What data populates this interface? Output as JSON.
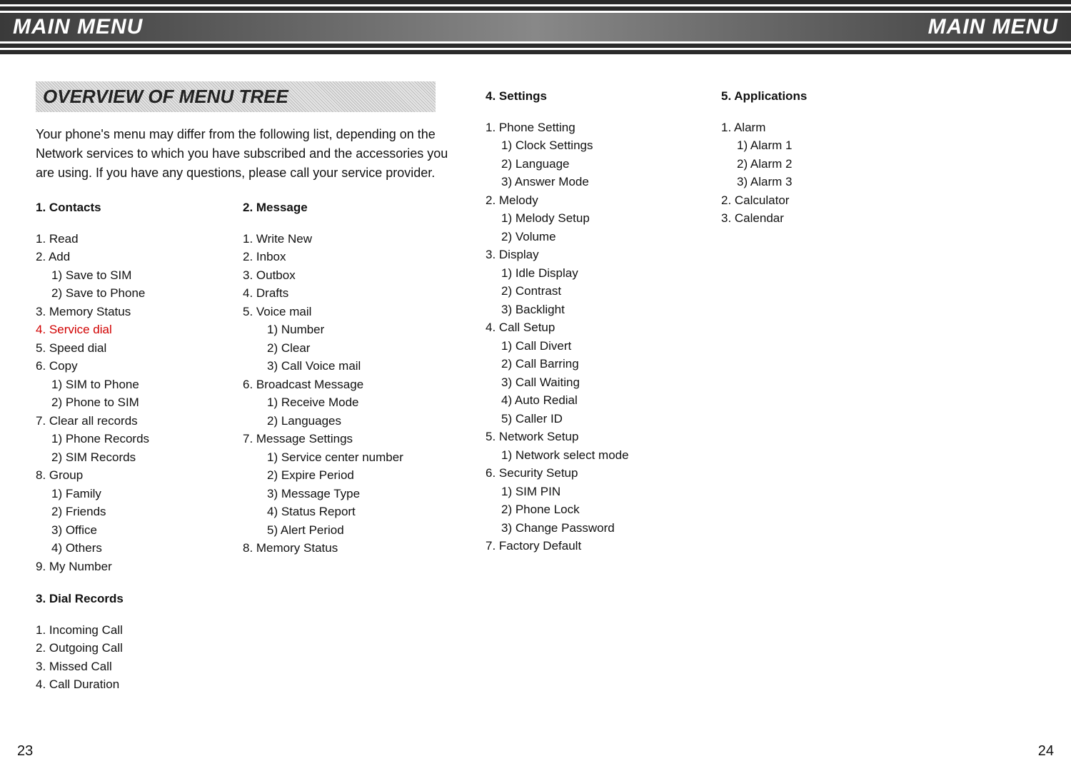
{
  "header": {
    "left_title": "MAIN MENU",
    "right_title": "MAIN MENU"
  },
  "section_header": "OVERVIEW OF MENU TREE",
  "intro": "Your phone's menu may differ from the following list, depending on the Network services to which you have subscribed and the accessories you are using. If you have any questions, please call your service provider.",
  "menu1": {
    "title": "1.   Contacts",
    "items": {
      "i1": "1. Read",
      "i2": "2. Add",
      "i2a": "1) Save to SIM",
      "i2b": "2) Save to Phone",
      "i3": "3. Memory Status",
      "i4": "4. Service dial",
      "i5": "5. Speed dial",
      "i6": "6. Copy",
      "i6a": "1) SIM to Phone",
      "i6b": "2) Phone to SIM",
      "i7": "7. Clear all records",
      "i7a": "1) Phone Records",
      "i7b": "2) SIM Records",
      "i8": "8. Group",
      "i8a": "1) Family",
      "i8b": "2) Friends",
      "i8c": "3) Office",
      "i8d": "4) Others",
      "i9": "9. My Number"
    }
  },
  "menu2": {
    "title": "2.     Message",
    "items": {
      "i1": "1. Write New",
      "i2": "2. Inbox",
      "i3": "3. Outbox",
      "i4": "4. Drafts",
      "i5": " 5. Voice mail",
      "i5a": "1) Number",
      "i5b": "2) Clear",
      "i5c": " 3) Call Voice mail",
      "i6": "6. Broadcast Message",
      "i6a": "1) Receive Mode",
      "i6b": "2) Languages",
      "i7": "7. Message Settings",
      "i7a": "1) Service center number",
      "i7b": "2) Expire Period",
      "i7c": "3) Message Type",
      "i7d": "4) Status Report",
      "i7e": "5) Alert Period",
      "i8": "8. Memory Status"
    }
  },
  "menu3": {
    "title": "3.  Dial Records",
    "items": {
      "i1": "1. Incoming Call",
      "i2": "2. Outgoing Call",
      "i3": "3. Missed Call",
      "i4": "4. Call Duration"
    }
  },
  "menu4": {
    "title": "4.  Settings",
    "items": {
      "i1": "1. Phone Setting",
      "i1a": "1) Clock Settings",
      "i1b": "2) Language",
      "i1c": "3) Answer Mode",
      "i2": "2. Melody",
      "i2a": "1) Melody Setup",
      "i2b": "2) Volume",
      "i3": "3. Display",
      "i3a": "1) Idle Display",
      "i3b": "2) Contrast",
      "i3c": "3) Backlight",
      "i4": "4. Call Setup",
      "i4a": "1) Call Divert",
      "i4b": "2) Call Barring",
      "i4c": "3) Call Waiting",
      "i4d": "4) Auto Redial",
      "i4e": "5) Caller ID",
      "i5": "5. Network Setup",
      "i5a": "1) Network select mode",
      "i6": "6. Security Setup",
      "i6a": "1) SIM PIN",
      "i6b": "2) Phone Lock",
      "i6c": "3) Change Password",
      "i7": "7. Factory Default"
    }
  },
  "menu5": {
    "title": "5.  Applications",
    "items": {
      "i1": "1. Alarm",
      "i1a": "1) Alarm 1",
      "i1b": "2) Alarm 2",
      "i1c": "3) Alarm 3",
      "i2": "2. Calculator",
      "i3": " 3. Calendar"
    }
  },
  "page_left": "23",
  "page_right": "24"
}
